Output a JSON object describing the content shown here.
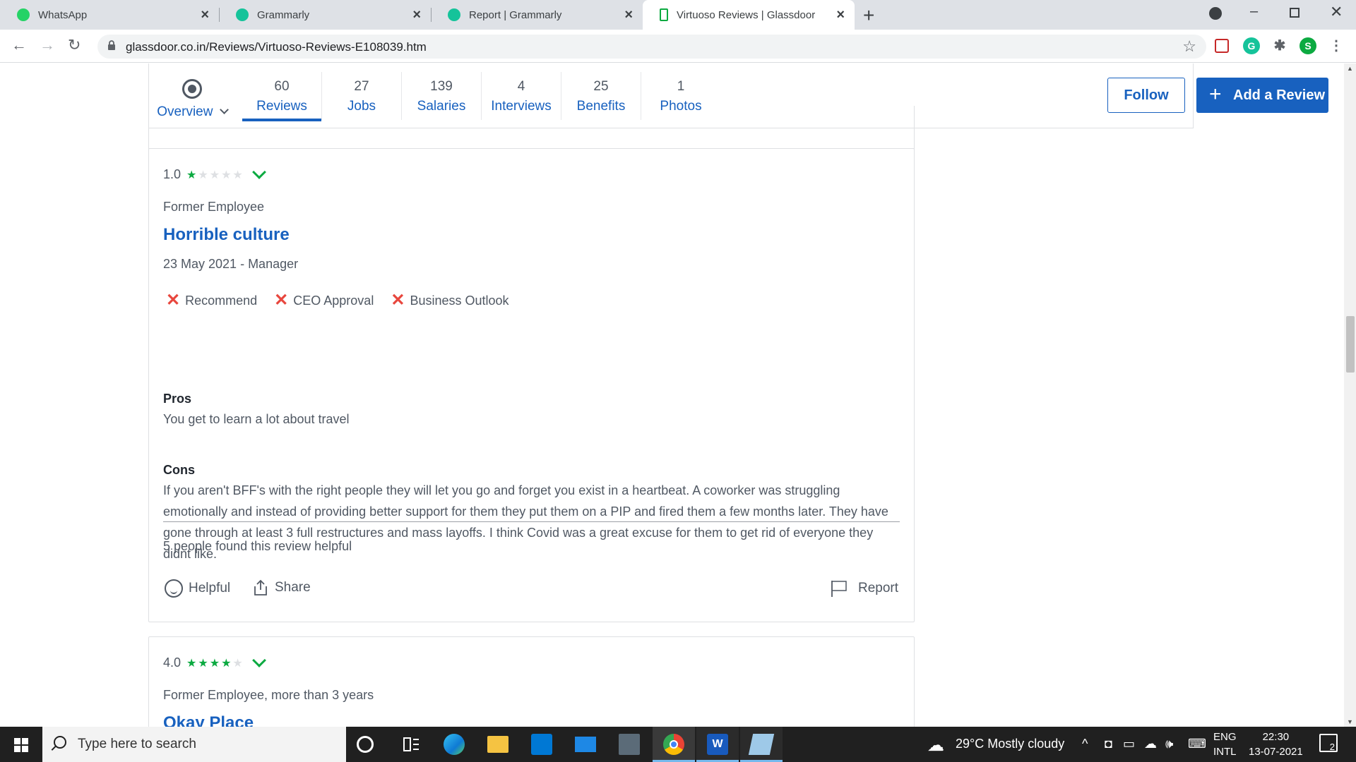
{
  "browser": {
    "tabs": [
      {
        "title": "WhatsApp",
        "icon": "whatsapp-icon",
        "active": false
      },
      {
        "title": "Grammarly",
        "icon": "grammarly-icon",
        "active": false
      },
      {
        "title": "Report | Grammarly",
        "icon": "grammarly-icon",
        "active": false
      },
      {
        "title": "Virtuoso Reviews | Glassdoor",
        "icon": "glassdoor-icon",
        "active": true
      }
    ],
    "url": "glassdoor.co.in/Reviews/Virtuoso-Reviews-E108039.htm",
    "profile_initial": "S"
  },
  "company_nav": {
    "overview_label": "Overview",
    "items": [
      {
        "count": "60",
        "label": "Reviews"
      },
      {
        "count": "27",
        "label": "Jobs"
      },
      {
        "count": "139",
        "label": "Salaries"
      },
      {
        "count": "4",
        "label": "Interviews"
      },
      {
        "count": "25",
        "label": "Benefits"
      },
      {
        "count": "1",
        "label": "Photos"
      }
    ],
    "follow_label": "Follow",
    "add_review_label": "Add a Review"
  },
  "reviews": [
    {
      "rating": "1.0",
      "stars": 1,
      "status": "Former Employee",
      "title": "Horrible culture",
      "date_role": "23 May 2021 - Manager",
      "ratings": [
        "Recommend",
        "CEO Approval",
        "Business Outlook"
      ],
      "pros_label": "Pros",
      "pros": "You get to learn a lot about travel",
      "cons_label": "Cons",
      "cons": "If you aren't BFF's with the right people they will let you go and forget you exist in a heartbeat. A coworker was struggling emotionally and instead of providing better support for them they put them on a PIP and fired them a few months later. They have gone through at least 3 full restructures and mass layoffs. I think Covid was a great excuse for them to get rid of everyone they didnt like.",
      "helpful_count": "5 people found this review helpful",
      "helpful_label": "Helpful",
      "share_label": "Share",
      "report_label": "Report"
    },
    {
      "rating": "4.0",
      "stars": 4,
      "status": "Former Employee, more than 3 years",
      "title": "Okay Place"
    }
  ],
  "taskbar": {
    "search_placeholder": "Type here to search",
    "weather": "29°C  Mostly cloudy",
    "lang": "ENG",
    "layout": "INTL",
    "time": "22:30",
    "date": "13-07-2021",
    "notifications": "2"
  },
  "colors": {
    "brand_blue": "#1861bf",
    "star_green": "#0caa41",
    "cross_red": "#e8473e"
  }
}
